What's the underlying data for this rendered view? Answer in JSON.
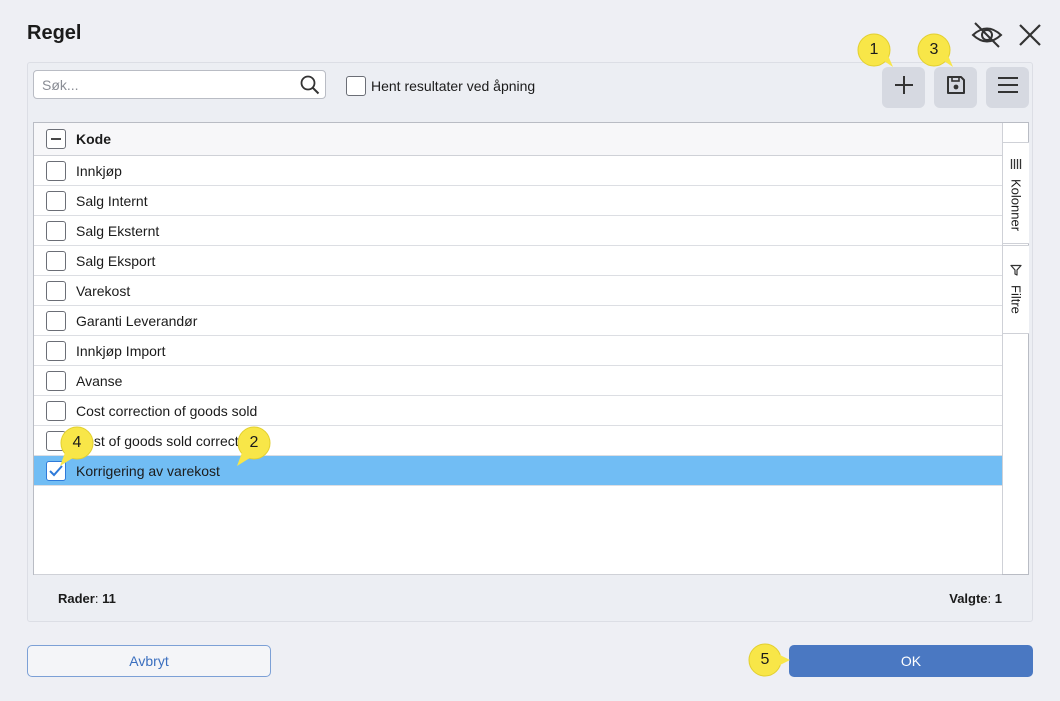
{
  "dialog": {
    "title": "Regel"
  },
  "search": {
    "placeholder": "Søk..."
  },
  "options": {
    "fetch_on_open_label": "Hent resultater ved åpning",
    "fetch_on_open_checked": false
  },
  "grid": {
    "column_header": "Kode",
    "rows": [
      {
        "label": "Innkjøp",
        "checked": false
      },
      {
        "label": "Salg Internt",
        "checked": false
      },
      {
        "label": "Salg Eksternt",
        "checked": false
      },
      {
        "label": "Salg Eksport",
        "checked": false
      },
      {
        "label": "Varekost",
        "checked": false
      },
      {
        "label": "Garanti Leverandør",
        "checked": false
      },
      {
        "label": "Innkjøp Import",
        "checked": false
      },
      {
        "label": "Avanse",
        "checked": false
      },
      {
        "label": "Cost correction of goods sold",
        "checked": false
      },
      {
        "label": "Cost of goods sold correction",
        "checked": false
      },
      {
        "label": "Korrigering av varekost",
        "checked": true
      }
    ],
    "side_tabs": {
      "columns": "Kolonner",
      "filters": "Filtre"
    }
  },
  "status": {
    "rows_label": "Rader",
    "rows_count": "11",
    "selected_label": "Valgte",
    "selected_count": "1"
  },
  "buttons": {
    "cancel": "Avbryt",
    "ok": "OK"
  },
  "callouts": [
    "1",
    "2",
    "3",
    "4",
    "5"
  ],
  "colors": {
    "accent": "#4a78c2",
    "selected_row": "#71bdf4",
    "callout": "#f8e648"
  }
}
